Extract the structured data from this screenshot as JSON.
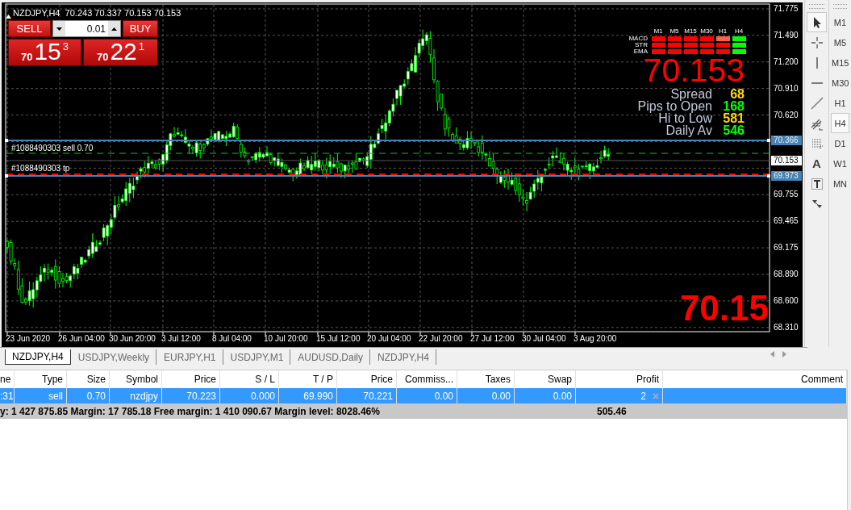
{
  "chart": {
    "symbol": "NZDJPY,H4",
    "ohlc": "70.243 70.337 70.153 70.153",
    "trade_panel": {
      "sell_label": "SELL",
      "buy_label": "BUY",
      "lot": "0.01",
      "sell_price": {
        "prefix": "70",
        "big": "15",
        "point": "3"
      },
      "buy_price": {
        "prefix": "70",
        "big": "22",
        "point": "1"
      }
    },
    "signal_columns": [
      "M1",
      "M5",
      "M15",
      "M30",
      "H1",
      "H4"
    ],
    "signal_rows": [
      {
        "label": "MACD",
        "cells": [
          {
            "color": "#ff0000"
          },
          {
            "color": "#ff0000"
          },
          {
            "color": "#ff0000"
          },
          {
            "color": "#ff0000"
          },
          {
            "color": "#ff6347"
          },
          {
            "color": "#00ff00"
          }
        ]
      },
      {
        "label": "STR",
        "cells": [
          {
            "color": "#ff0000"
          },
          {
            "color": "#ff0000"
          },
          {
            "color": "#ff0000"
          },
          {
            "color": "#ff0000"
          },
          {
            "color": "#ff0000"
          },
          {
            "color": "#00ff00"
          }
        ]
      },
      {
        "label": "EMA",
        "cells": [
          {
            "color": "#ff0000"
          },
          {
            "color": "#ff0000"
          },
          {
            "color": "#ff0000"
          },
          {
            "color": "#ff0000"
          },
          {
            "color": "#ff0000"
          },
          {
            "color": "#00ff00"
          }
        ]
      }
    ],
    "big_price": "70.153",
    "stats": [
      {
        "label": "Spread",
        "value": "68",
        "color": "#ffd700"
      },
      {
        "label": "Pips to Open",
        "value": "168",
        "color": "#00ff00"
      },
      {
        "label": "Hi to Low",
        "value": "581",
        "color": "#ffd700"
      },
      {
        "label": "Daily Av",
        "value": "546",
        "color": "#00ff00"
      }
    ],
    "order_labels": [
      "#1088490303 sell 0.70",
      "#1088490303 tp"
    ],
    "corner_price": "70.15",
    "price_ticks": [
      "71.775",
      "71.490",
      "71.200",
      "70.910",
      "70.620",
      "69.755",
      "69.465",
      "69.175",
      "68.890",
      "68.600",
      "68.310"
    ],
    "price_tags": [
      {
        "kind": "level",
        "text": "70.366"
      },
      {
        "kind": "bid",
        "text": "70.153"
      },
      {
        "kind": "level",
        "text": "69.973"
      }
    ],
    "time_ticks": [
      "23 Jun 2020",
      "26 Jun 04:00",
      "30 Jun 20:00",
      "3 Jul 12:00",
      "8 Jul 04:00",
      "10 Jul 20:00",
      "15 Jul 12:00",
      "20 Jul 04:00",
      "22 Jul 20:00",
      "27 Jul 12:00",
      "30 Jul 04:00",
      "3 Aug 20:00"
    ]
  },
  "drawing_tools": [
    {
      "kind": "cursor",
      "selected": true
    },
    {
      "kind": "crosshair",
      "selected": false
    },
    {
      "kind": "vline",
      "selected": false
    },
    {
      "kind": "hline",
      "selected": false
    },
    {
      "kind": "trend",
      "selected": false
    },
    {
      "kind": "fibo-e",
      "selected": false
    },
    {
      "kind": "fibo-f",
      "selected": false
    },
    {
      "kind": "text",
      "selected": false
    },
    {
      "kind": "label",
      "selected": false
    },
    {
      "kind": "arrows",
      "selected": false
    }
  ],
  "text_tool_letter": "A",
  "timeframes": [
    {
      "label": "M1",
      "selected": false
    },
    {
      "label": "M5",
      "selected": false
    },
    {
      "label": "M15",
      "selected": false
    },
    {
      "label": "M30",
      "selected": false
    },
    {
      "label": "H1",
      "selected": false
    },
    {
      "label": "H4",
      "selected": true
    },
    {
      "label": "D1",
      "selected": false
    },
    {
      "label": "W1",
      "selected": false
    },
    {
      "label": "MN",
      "selected": false
    }
  ],
  "chart_tabs": [
    {
      "label": "NZDJPY,H4",
      "selected": true
    },
    {
      "label": "USDJPY,Weekly",
      "selected": false
    },
    {
      "label": "EURJPY,H1",
      "selected": false
    },
    {
      "label": "USDJPY,M1",
      "selected": false
    },
    {
      "label": "AUDUSD,Daily",
      "selected": false
    },
    {
      "label": "NZDJPY,H4",
      "selected": false
    }
  ],
  "table": {
    "columns": [
      "ne",
      "Type",
      "Size",
      "Symbol",
      "Price",
      "S / L",
      "T / P",
      "Price",
      "Commiss...",
      "Taxes",
      "Swap",
      "Profit",
      "Comment"
    ],
    "rows": [
      {
        "selected": true,
        "cells": [
          ":31",
          "sell",
          "0.70",
          "nzdjpy",
          "70.223",
          "0.000",
          "69.990",
          "70.221",
          "0.00",
          "0.00",
          "0.00",
          "2",
          ""
        ]
      }
    ],
    "summary": "y: 1 427 875.85  Margin: 17 785.18  Free margin: 1 410 090.67  Margin level: 8028.46%",
    "summary_profit": "505.46"
  }
}
